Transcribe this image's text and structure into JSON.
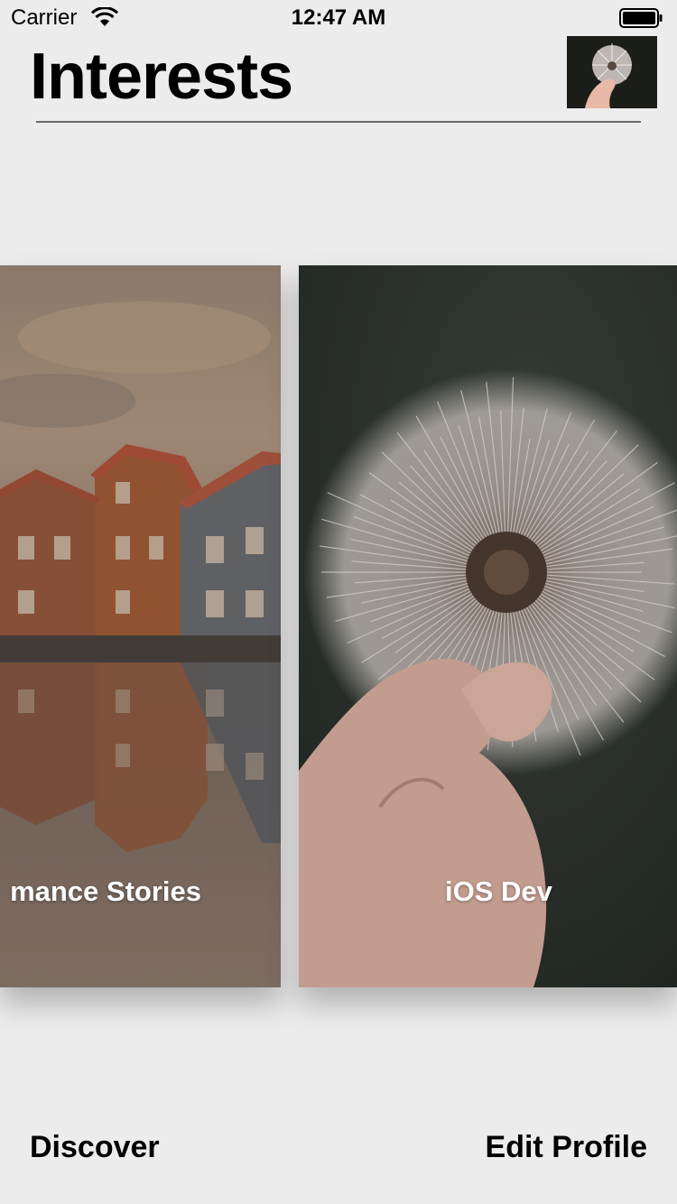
{
  "status_bar": {
    "carrier": "Carrier",
    "time": "12:47 AM",
    "icons": [
      "wifi-icon",
      "battery-icon"
    ]
  },
  "header": {
    "title": "Interests",
    "avatar_icon": "dandelion-photo"
  },
  "cards": [
    {
      "label": "Romance Stories",
      "visible_label": "mance Stories",
      "image": "houses-reflection-photo"
    },
    {
      "label": "iOS Dev",
      "image": "dandelion-photo"
    }
  ],
  "bottom_nav": {
    "discover": "Discover",
    "edit_profile": "Edit Profile"
  },
  "colors": {
    "background": "#ececec",
    "text": "#000000",
    "card_label": "#ffffff"
  }
}
